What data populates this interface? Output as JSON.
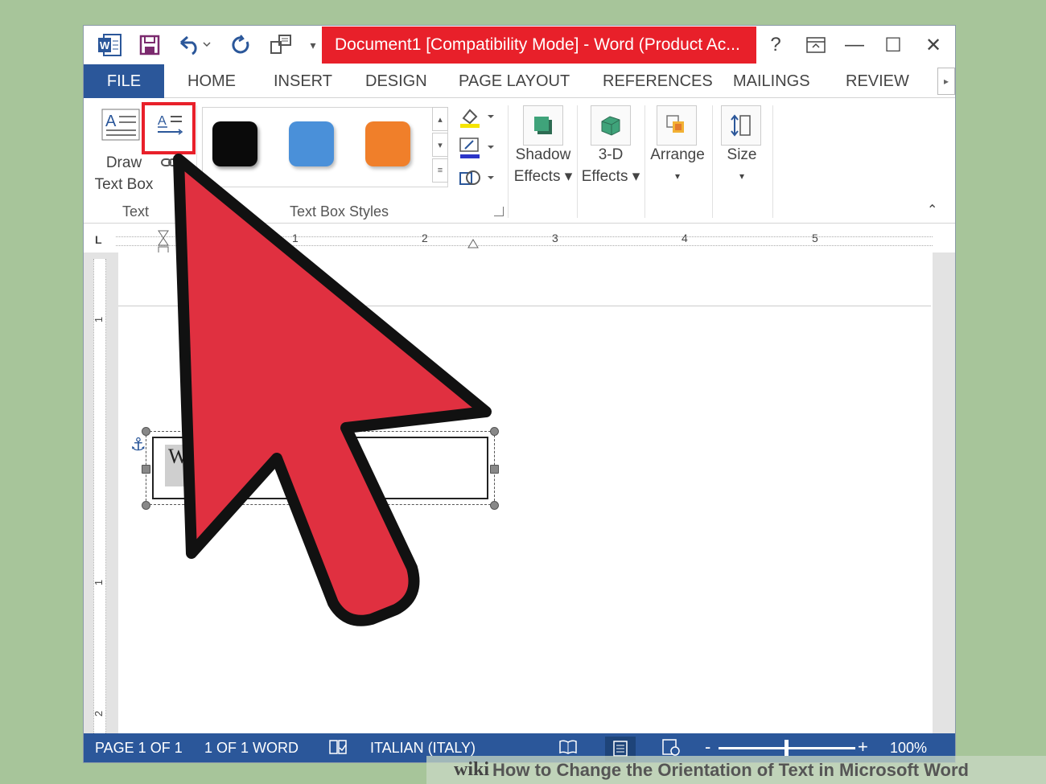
{
  "titlebar": {
    "title": "Document1 [Compatibility Mode] -  Word (Product Ac...",
    "help": "?",
    "minimize": "—",
    "maximize": "☐",
    "close": "✕"
  },
  "tabs": [
    "FILE",
    "HOME",
    "INSERT",
    "DESIGN",
    "PAGE LAYOUT",
    "REFERENCES",
    "MAILINGS",
    "REVIEW"
  ],
  "ribbon": {
    "draw_text_box": [
      "Draw",
      "Text Box"
    ],
    "group_text": "Text",
    "group_text_box_styles": "Text Box Styles",
    "shadow_effects": [
      "Shadow",
      "Effects ▾"
    ],
    "three_d_effects": [
      "3-D",
      "Effects ▾"
    ],
    "arrange": "Arrange",
    "size": "Size",
    "swatch_colors": [
      "#0a0a0a",
      "#4a90d9",
      "#f07f2a"
    ]
  },
  "ruler": {
    "numbers": [
      "1",
      "2",
      "3",
      "4",
      "5"
    ]
  },
  "vruler": {
    "numbers": [
      "1",
      "1",
      "2"
    ]
  },
  "document": {
    "textbox_text": "W"
  },
  "status": {
    "page": "PAGE 1 OF 1",
    "words": "1 OF 1 WORD",
    "language": "ITALIAN (ITALY)",
    "zoom": "100%",
    "zoom_minus": "-",
    "zoom_plus": "+"
  },
  "watermark": {
    "brand": "wiki",
    "text": "How to Change the Orientation of Text in Microsoft Word"
  },
  "colors": {
    "accent": "#2b579a",
    "callout_red": "#e8202a",
    "background": "#a7c59a"
  }
}
